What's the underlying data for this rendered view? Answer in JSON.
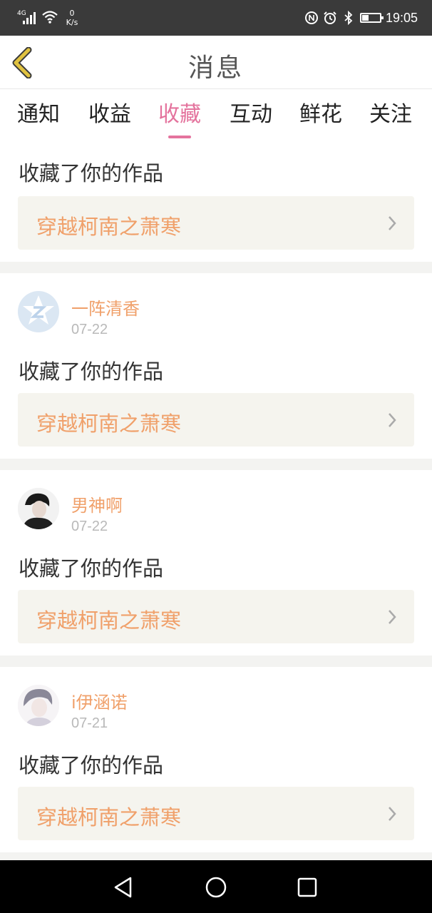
{
  "status_bar": {
    "network_type": "4G",
    "net_speed_value": "0",
    "net_speed_unit": "K/s",
    "time": "19:05",
    "battery_level": 0.35,
    "icons": [
      "signal-icon",
      "wifi-icon",
      "nfc-icon",
      "alarm-icon",
      "bluetooth-icon",
      "battery-icon"
    ]
  },
  "header": {
    "title": "消息",
    "back_icon": "chevron-left-icon"
  },
  "tabs": [
    {
      "label": "通知"
    },
    {
      "label": "收益"
    },
    {
      "label": "收藏"
    },
    {
      "label": "互动"
    },
    {
      "label": "鲜花"
    },
    {
      "label": "关注"
    }
  ],
  "active_tab": "收藏",
  "feed": [
    {
      "action": "收藏了你的作品",
      "work_title": "穿越柯南之萧寒"
    },
    {
      "user": "一阵清香",
      "date": "07-22",
      "action": "收藏了你的作品",
      "work_title": "穿越柯南之萧寒"
    },
    {
      "user": "男神啊",
      "date": "07-22",
      "action": "收藏了你的作品",
      "work_title": "穿越柯南之萧寒"
    },
    {
      "user": "i伊涵诺",
      "date": "07-21",
      "action": "收藏了你的作品",
      "work_title": "穿越柯南之萧寒"
    }
  ],
  "colors": {
    "accent_pink": "#e4739d",
    "orange_text": "#f0a06a",
    "back_arrow_gold": "#e0c240",
    "card_background": "#f5f4ee"
  },
  "nav_bar": {
    "buttons": [
      "back-triangle-icon",
      "home-circle-icon",
      "recents-square-icon"
    ]
  }
}
